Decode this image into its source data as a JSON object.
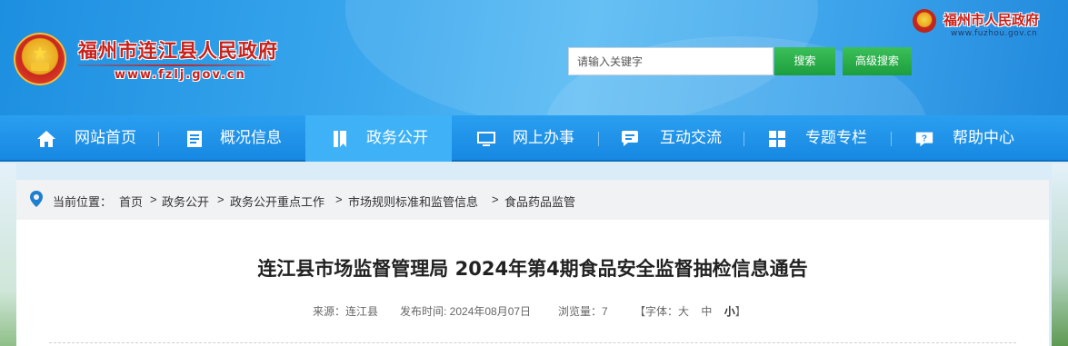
{
  "header": {
    "site_title": "福州市连江县人民政府",
    "site_domain": "www.fzlj.gov.cn",
    "city_title": "福州市人民政府",
    "city_domain": "www.fuzhou.gov.cn",
    "search_placeholder": "请输入关键字",
    "search_value": "",
    "search_button": "搜索",
    "advanced_search_button": "高级搜索"
  },
  "nav": {
    "items": [
      {
        "label": "网站首页",
        "icon": "home-icon"
      },
      {
        "label": "概况信息",
        "icon": "document-icon"
      },
      {
        "label": "政务公开",
        "icon": "book-icon",
        "active": true
      },
      {
        "label": "网上办事",
        "icon": "monitor-icon"
      },
      {
        "label": "互动交流",
        "icon": "chat-icon"
      },
      {
        "label": "专题专栏",
        "icon": "grid-icon"
      },
      {
        "label": "帮助中心",
        "icon": "help-icon"
      }
    ]
  },
  "breadcrumb": {
    "label": "当前位置：",
    "items": [
      "首页",
      "政务公开",
      "政务公开重点工作",
      "市场规则标准和监管信息",
      "食品药品监管"
    ],
    "separator": ">"
  },
  "article": {
    "title": "连江县市场监督管理局 2024年第4期食品安全监督抽检信息通告",
    "source": "来源：连江县",
    "publish_time": "发布时间: 2024年08月07日",
    "views": "浏览量：7",
    "font_size_label": "【字体：",
    "font_large": "大",
    "font_medium": "中",
    "font_small": "小",
    "font_close": "】"
  },
  "colors": {
    "nav_bg": "#1e90e8",
    "nav_active": "#3fb2f7",
    "brand_red": "#c8201a",
    "button_green": "#25a845"
  }
}
